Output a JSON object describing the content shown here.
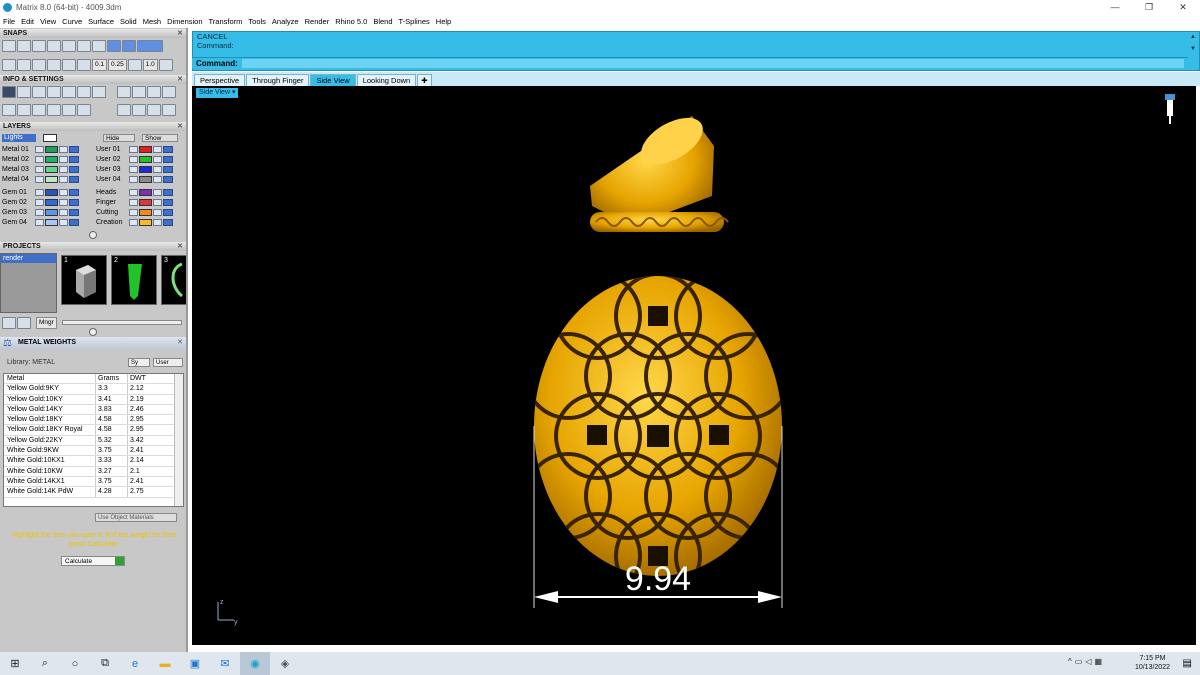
{
  "window": {
    "title": "Matrix 8.0 (64-bit) - 4009.3dm",
    "controls": [
      "—",
      "❐",
      "✕"
    ]
  },
  "menu": [
    "File",
    "Edit",
    "View",
    "Curve",
    "Surface",
    "Solid",
    "Mesh",
    "Dimension",
    "Transform",
    "Tools",
    "Analyze",
    "Render",
    "Rhino 5.0",
    "Blend",
    "T-Splines",
    "Help"
  ],
  "panels": {
    "snaps": "SNAPS",
    "snap_values": [
      "0.1",
      "0.25",
      "1.0"
    ],
    "info": "INFO & SETTINGS",
    "layers": "LAYERS",
    "projects": "PROJECTS",
    "metal_weights": "METAL WEIGHTS"
  },
  "layers": {
    "lights": "Lights",
    "hide": "Hide",
    "show": "Show",
    "left": [
      {
        "name": "Metal 01",
        "color": "#1f9e5a"
      },
      {
        "name": "Metal 02",
        "color": "#1fb06a"
      },
      {
        "name": "Metal 03",
        "color": "#5ed690"
      },
      {
        "name": "Metal 04",
        "color": "#bfe9c9"
      },
      {
        "name": "Gem 01",
        "color": "#2855b8"
      },
      {
        "name": "Gem 02",
        "color": "#2f6bd6"
      },
      {
        "name": "Gem 03",
        "color": "#5d98e8"
      },
      {
        "name": "Gem 04",
        "color": "#a8c8f2"
      }
    ],
    "right": [
      {
        "name": "User 01",
        "color": "#e0201e"
      },
      {
        "name": "User 02",
        "color": "#21c22a"
      },
      {
        "name": "User 03",
        "color": "#1c2ad8"
      },
      {
        "name": "User 04",
        "color": "#8a8a8a"
      },
      {
        "name": "Heads",
        "color": "#7a2fb4"
      },
      {
        "name": "Finger",
        "color": "#d63a3a"
      },
      {
        "name": "Cutting",
        "color": "#f08a1c"
      },
      {
        "name": "Creation",
        "color": "#f7b82a"
      }
    ]
  },
  "projects": {
    "selected": "render",
    "thumb_numbers": [
      "1",
      "2",
      "3"
    ],
    "mngr_label": "Mngr"
  },
  "metal": {
    "library_label": "Library: METAL",
    "toggles": [
      "Sy",
      "User"
    ],
    "headers": [
      "Metal",
      "Grams",
      "DWT"
    ],
    "rows": [
      [
        "Yellow Gold:9KY",
        "3.3",
        "2.12"
      ],
      [
        "Yellow Gold:10KY",
        "3.41",
        "2.19"
      ],
      [
        "Yellow Gold:14KY",
        "3.83",
        "2.46"
      ],
      [
        "Yellow Gold:18KY",
        "4.58",
        "2.95"
      ],
      [
        "Yellow Gold:18KY Royal",
        "4.58",
        "2.95"
      ],
      [
        "Yellow Gold:22KY",
        "5.32",
        "3.42"
      ],
      [
        "White Gold:9KW",
        "3.75",
        "2.41"
      ],
      [
        "White Gold:10KX1",
        "3.33",
        "2.14"
      ],
      [
        "White Gold:10KW",
        "3.27",
        "2.1"
      ],
      [
        "White Gold:14KX1",
        "3.75",
        "2.41"
      ],
      [
        "White Gold:14K PdW",
        "4.28",
        "2.75"
      ]
    ],
    "use_object_materials": "Use Object Materials",
    "hint": "Highlight the item you want to find the weight for then press Calculate.",
    "calculate": "Calculate"
  },
  "command": {
    "line1": "CANCEL",
    "line2": "Command:",
    "prompt": "Command:"
  },
  "tabs": [
    "Perspective",
    "Through Finger",
    "Side View",
    "Looking Down"
  ],
  "active_tab": "Side View",
  "viewport": {
    "label": "Side View",
    "dimension_value": "9.94",
    "axis_z": "z",
    "axis_y": "y"
  },
  "taskbar": {
    "time": "7:15 PM",
    "date": "10/13/2022"
  },
  "colors": {
    "accent": "#35bde8",
    "gold": "#f2b514",
    "viewport_bg": "#000000"
  }
}
